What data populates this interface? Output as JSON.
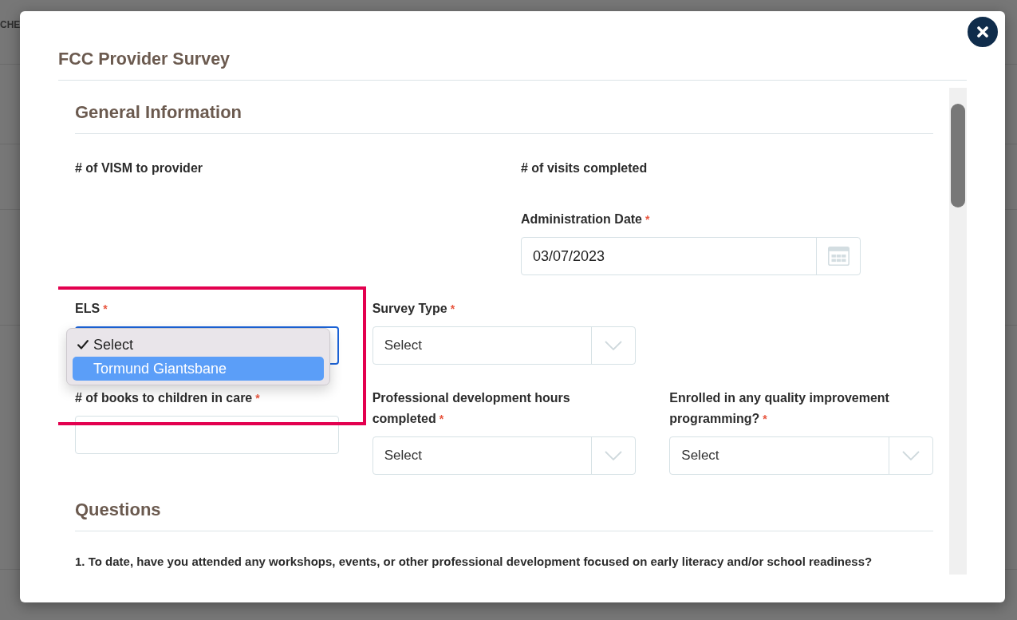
{
  "background_page": {
    "heading_fragment": "CHE"
  },
  "dialog": {
    "title": "FCC Provider Survey",
    "sections": [
      {
        "heading": "General Information",
        "rows": [
          {
            "kind": "halves",
            "columns": [
              [
                {
                  "kind": "static",
                  "label": "# of VISM to provider"
                }
              ],
              [
                {
                  "kind": "static",
                  "label": "# of visits completed"
                },
                {
                  "kind": "date",
                  "label": "Administration Date",
                  "required_mark": "*",
                  "value": "03/07/2023",
                  "focused": false
                }
              ]
            ]
          },
          {
            "kind": "thirds",
            "columns": [
              [
                {
                  "kind": "select",
                  "label": "ELS",
                  "required_mark": "*",
                  "focused": true,
                  "expanded": true,
                  "highlight_outline": true,
                  "options": [
                    {
                      "label": "Select",
                      "selected": true,
                      "highlighted": false
                    },
                    {
                      "label": "Tormund Giantsbane",
                      "selected": false,
                      "highlighted": true
                    }
                  ]
                }
              ],
              [
                {
                  "kind": "select",
                  "label": "Survey Type",
                  "required_mark": "*",
                  "value": "Select",
                  "focused": false,
                  "expanded": false
                }
              ]
            ]
          },
          {
            "kind": "thirds",
            "columns": [
              [
                {
                  "kind": "text",
                  "label": "# of books to children in care",
                  "required_mark": "*",
                  "focused": false
                }
              ],
              [
                {
                  "kind": "select",
                  "label": "Professional development hours completed",
                  "required_mark": "*",
                  "value": "Select",
                  "focused": false,
                  "expanded": false
                }
              ],
              [
                {
                  "kind": "select",
                  "label": "Enrolled in any quality improvement programming?",
                  "required_mark": "*",
                  "value": "Select",
                  "focused": false,
                  "expanded": false
                }
              ]
            ]
          }
        ]
      },
      {
        "heading": "Questions",
        "questions": [
          {
            "number": "1.",
            "text": "To date, have you attended any workshops, events, or other professional development focused on early literacy and/or school readiness?"
          }
        ]
      }
    ]
  }
}
